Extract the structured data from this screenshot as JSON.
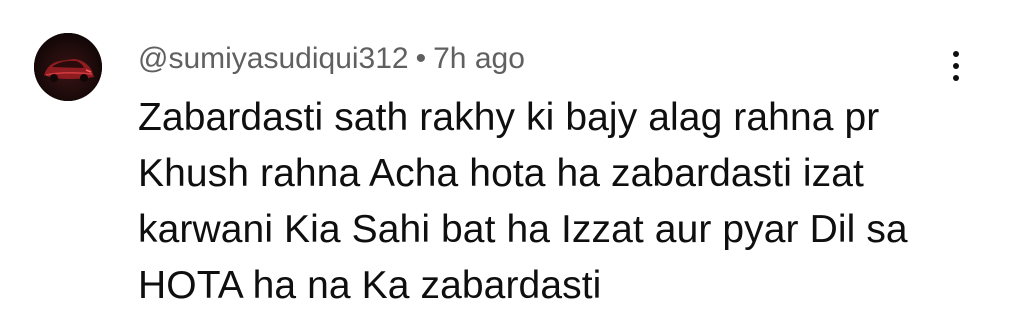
{
  "comment": {
    "author_handle": "@sumiyasudiqui312",
    "separator": "•",
    "timestamp": "7h ago",
    "text": "Zabardasti sath rakhy ki bajy alag rahna pr Khush rahna Acha hota ha zabardasti izat karwani Kia Sahi bat ha Izzat aur pyar Dil sa HOTA ha na Ka zabardasti",
    "avatar_icon": "car-avatar-icon",
    "more_icon": "more-vertical-icon"
  },
  "colors": {
    "meta_text": "#606060",
    "body_text": "#0f0f0f",
    "avatar_bg": "#1a0b0b",
    "avatar_accent": "#b3262a"
  }
}
